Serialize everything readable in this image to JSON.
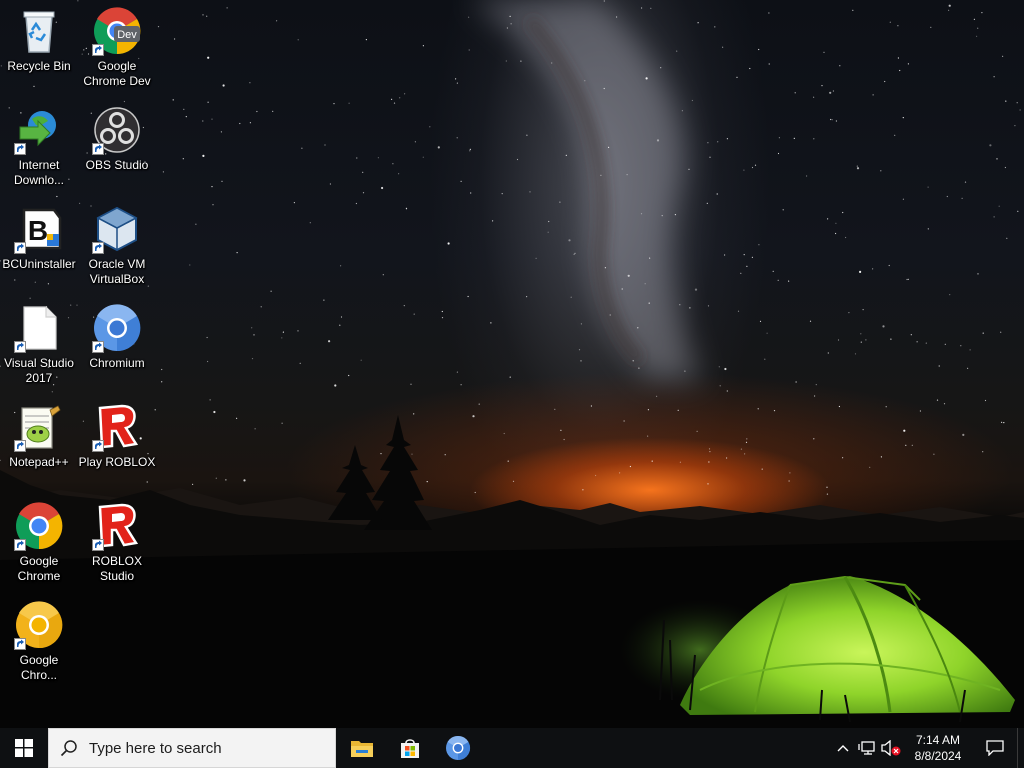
{
  "desktop": {
    "icons": [
      {
        "label": "Recycle Bin",
        "icon": "recycle-bin-icon"
      },
      {
        "label": "Google Chrome Dev",
        "icon": "chrome-dev-icon",
        "badge": "Dev"
      },
      {
        "label": "Internet Downlo...",
        "icon": "internet-download-manager-icon"
      },
      {
        "label": "OBS Studio",
        "icon": "obs-studio-icon"
      },
      {
        "label": "BCUninstaller",
        "icon": "bcuninstaller-icon"
      },
      {
        "label": "Oracle VM VirtualBox",
        "icon": "virtualbox-icon"
      },
      {
        "label": "Visual Studio 2017",
        "icon": "blank-file-icon"
      },
      {
        "label": "Chromium",
        "icon": "chromium-icon"
      },
      {
        "label": "Notepad++",
        "icon": "notepad-plus-plus-icon"
      },
      {
        "label": "Play ROBLOX",
        "icon": "roblox-icon"
      },
      {
        "label": "Google Chrome",
        "icon": "chrome-icon"
      },
      {
        "label": "ROBLOX Studio",
        "icon": "roblox-studio-icon"
      },
      {
        "label": "Google Chro...",
        "icon": "chrome-canary-icon"
      }
    ]
  },
  "taskbar": {
    "start_icon": "windows-start-icon",
    "search_placeholder": "Type here to search",
    "pinned": [
      {
        "name": "File Explorer",
        "icon": "file-explorer-icon"
      },
      {
        "name": "Microsoft Store",
        "icon": "microsoft-store-icon"
      },
      {
        "name": "Chromium",
        "icon": "chromium-icon"
      }
    ],
    "tray": {
      "icons": [
        "chevron-up-icon",
        "network-icon",
        "volume-muted-icon"
      ],
      "time": "7:14 AM",
      "date": "8/8/2024",
      "notification_icon": "action-center-icon"
    }
  },
  "colors": {
    "taskbar_bg": "#0e1012",
    "search_bg": "#f3f3f3",
    "chrome_red": "#db4437",
    "chrome_yellow": "#f4b400",
    "chrome_green": "#0f9d58",
    "chrome_blue": "#4285f4",
    "roblox_red": "#e2231a",
    "tent_green": "#8fd42a"
  }
}
